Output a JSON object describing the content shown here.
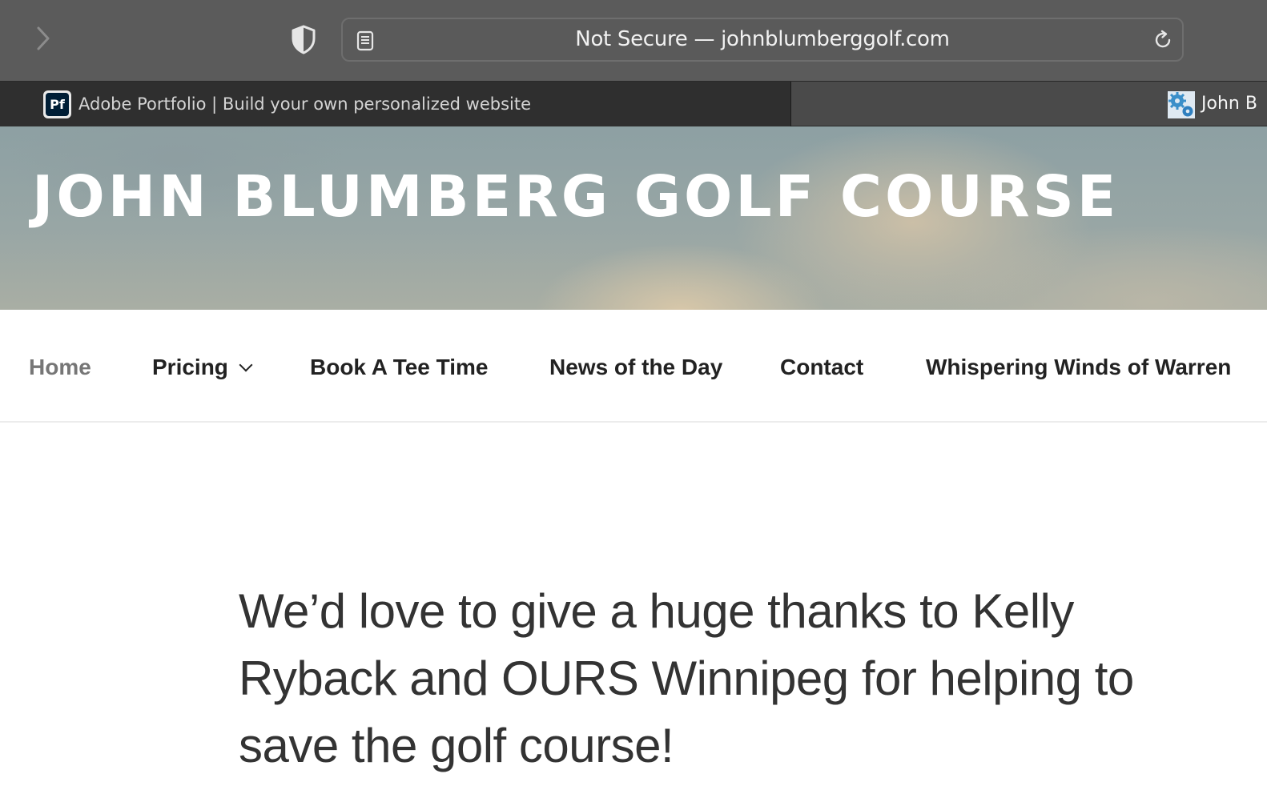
{
  "browser": {
    "url_text": "Not Secure — johnblumberggolf.com",
    "tabs": [
      {
        "label": "Adobe Portfolio | Build your own personalized website",
        "favicon": "Pf"
      },
      {
        "label": "John B"
      }
    ]
  },
  "site": {
    "title": "JOHN BLUMBERG GOLF COURSE"
  },
  "nav": {
    "items": [
      {
        "label": "Home"
      },
      {
        "label": "Pricing"
      },
      {
        "label": "Book A Tee Time"
      },
      {
        "label": "News of the Day"
      },
      {
        "label": "Contact"
      },
      {
        "label": "Whispering Winds of Warren"
      }
    ]
  },
  "content": {
    "headline": "We’d love to give a huge thanks to Kelly Ryback and OURS Winnipeg for helping to save the golf course!"
  },
  "colors": {
    "toolbar_bg": "#5b5b5b",
    "active_tab_bg": "#2f2f2f",
    "nav_active": "#767676",
    "nav_text": "#222222",
    "body_text": "#333333"
  },
  "icons": [
    "forward-icon",
    "shield-icon",
    "reader-icon",
    "reload-icon",
    "portfolio-favicon",
    "gear-favicon",
    "chevron-down-icon"
  ]
}
